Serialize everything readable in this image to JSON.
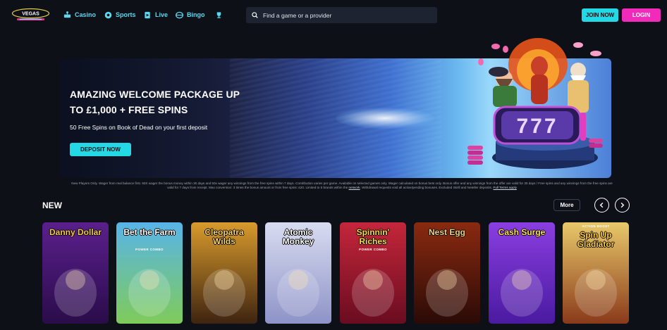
{
  "header": {
    "logo_text": "VEGAS",
    "nav": [
      {
        "label": "Casino",
        "icon": "joystick-icon"
      },
      {
        "label": "Sports",
        "icon": "soccer-ball-icon"
      },
      {
        "label": "Live",
        "icon": "live-card-icon"
      },
      {
        "label": "Bingo",
        "icon": "bingo-ball-icon"
      },
      {
        "label": "",
        "icon": "trophy-icon"
      }
    ],
    "search_placeholder": "Find a game or a provider",
    "join_label": "JOIN NOW",
    "login_label": "LOGIN"
  },
  "banner": {
    "headline": "AMAZING WELCOME PACKAGE UP TO £1,000 + FREE SPINS",
    "subline": "50 Free Spins on Book of Dead on your first deposit",
    "cta_label": "DEPOSIT NOW",
    "reel_symbols": "777"
  },
  "terms": {
    "text": "New Players Only. Wager from real balance first. 50X wager the bonus money within 30 days and 50x wager any winnings from the free spins within 7 days. Contribution varies per game. Available on selected games only. Wager calculated on bonus bets only. Bonus offer and any winnings from the offer are valid for 30 days / Free spins and any winnings from the free spins are valid for 7 days from receipt. Max conversion: 3 times the bonus amount or from free spins: £20. Limited to 5 brands within the",
    "link_network": "network",
    "text_2": ". Withdrawal requests void all active/pending bonuses. Excluded Skrill and Neteller deposits.",
    "link_full": "Full Terms apply"
  },
  "section": {
    "title": "NEW",
    "more_label": "More"
  },
  "games": [
    {
      "name": "Danny Dollar",
      "sub": "",
      "bg1": "#5a1f8c",
      "bg2": "#2a0c4a"
    },
    {
      "name": "Bet the Farm",
      "sub": "POWER COMBO",
      "bg1": "#58b4e8",
      "bg2": "#7fcb5a"
    },
    {
      "name": "Cleopatra Wilds",
      "sub": "",
      "bg1": "#d89a2c",
      "bg2": "#3e2410"
    },
    {
      "name": "Atomic Monkey",
      "sub": "",
      "bg1": "#d8dcf0",
      "bg2": "#8e93c8"
    },
    {
      "name": "Spinnin' Riches",
      "sub": "POWER COMBO",
      "bg1": "#c4263a",
      "bg2": "#6a0c20"
    },
    {
      "name": "Nest Egg",
      "sub": "",
      "bg1": "#8a2a10",
      "bg2": "#2a0a06"
    },
    {
      "name": "Cash Surge",
      "sub": "",
      "bg1": "#8a3ee0",
      "bg2": "#4a1aa0"
    },
    {
      "name": "Spin Up Gladiator",
      "sub": "ACTION BOOST",
      "bg1": "#e8c86a",
      "bg2": "#8a3a1a"
    }
  ],
  "colors": {
    "background": "#0d1117",
    "accent_cyan": "#23d9e6",
    "accent_pink": "#f02ab9",
    "nav_text": "#5ad8f0"
  }
}
